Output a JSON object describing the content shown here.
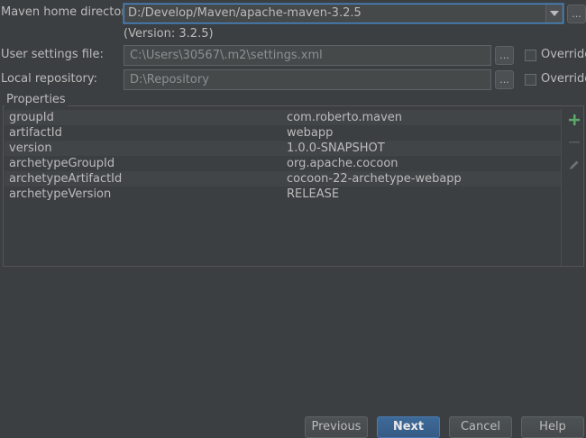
{
  "maven_home": {
    "label": "Maven home directory:",
    "value": "D:/Develop/Maven/apache-maven-3.2.5",
    "version": "(Version: 3.2.5)"
  },
  "user_settings": {
    "label": "User settings file:",
    "value": "C:\\Users\\30567\\.m2\\settings.xml",
    "override_label": "Override"
  },
  "local_repository": {
    "label": "Local repository:",
    "value": "D:\\Repository",
    "override_label": "Override"
  },
  "browse_label": "...",
  "properties": {
    "title": "Properties",
    "rows": [
      {
        "key": "groupId",
        "value": "com.roberto.maven"
      },
      {
        "key": "artifactId",
        "value": "webapp"
      },
      {
        "key": "version",
        "value": "1.0.0-SNAPSHOT"
      },
      {
        "key": "archetypeGroupId",
        "value": "org.apache.cocoon"
      },
      {
        "key": "archetypeArtifactId",
        "value": "cocoon-22-archetype-webapp"
      },
      {
        "key": "archetypeVersion",
        "value": "RELEASE"
      }
    ]
  },
  "buttons": {
    "previous": "Previous",
    "next": "Next",
    "cancel": "Cancel",
    "help": "Help"
  },
  "colors": {
    "background": "#3c3f41",
    "focus_border": "#4a88c7",
    "add_icon": "#59a869"
  },
  "icons": {
    "add": "plus-icon",
    "remove": "minus-icon",
    "edit": "pencil-icon",
    "dropdown": "chevron-down-icon"
  }
}
